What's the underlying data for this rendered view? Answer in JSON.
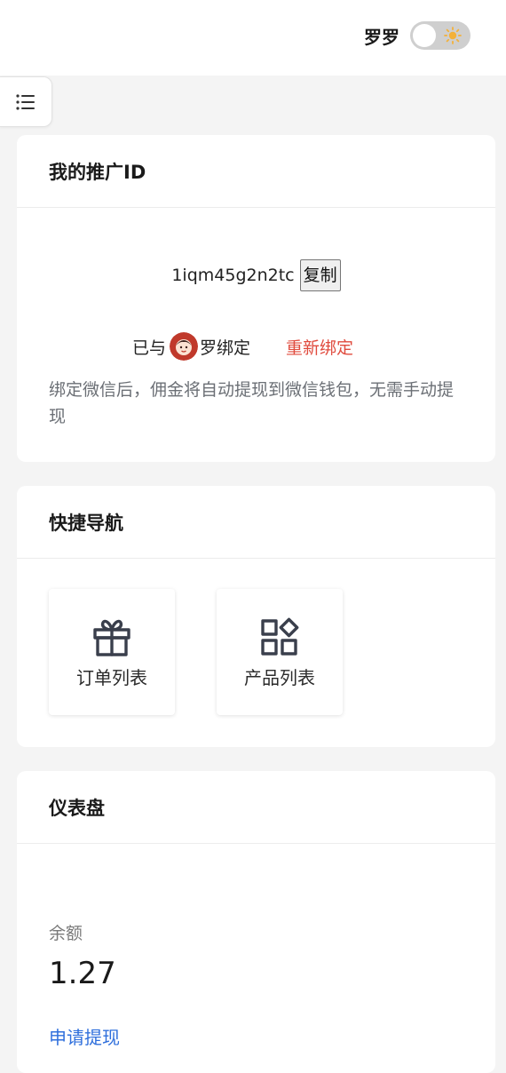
{
  "header": {
    "username": "罗罗",
    "theme_toggle": {
      "state": "light",
      "icon": "sun-icon"
    }
  },
  "sidebar_toggle": {
    "icon": "list-icon"
  },
  "promo_card": {
    "title": "我的推广ID",
    "promo_id": "1iqm45g2n2tc",
    "copy_label": "复制",
    "bind_prefix": "已与",
    "bind_name": "罗",
    "bind_suffix": "绑定",
    "rebind_label": "重新绑定",
    "note": "绑定微信后，佣金将自动提现到微信钱包，无需手动提现"
  },
  "nav_card": {
    "title": "快捷导航",
    "tiles": [
      {
        "label": "订单列表",
        "icon": "gift-icon"
      },
      {
        "label": "产品列表",
        "icon": "apps-icon"
      }
    ]
  },
  "dashboard_card": {
    "title": "仪表盘",
    "balance_label": "余额",
    "balance_value": "1.27",
    "withdraw_label": "申请提现"
  },
  "colors": {
    "accent_link": "#2f6fdc",
    "danger_link": "#e04b3e",
    "page_bg": "#f4f4f4",
    "toggle_track": "#cfcfcf",
    "sun": "#f3b13a"
  }
}
